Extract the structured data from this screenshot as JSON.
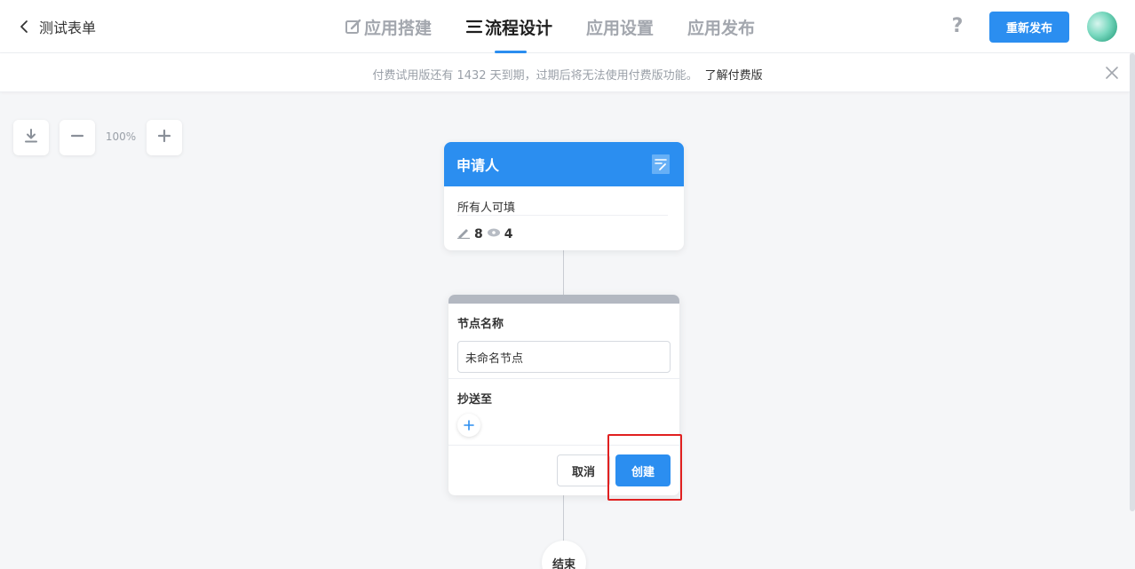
{
  "header": {
    "back_title": "测试表单",
    "tabs": [
      {
        "label": "应用搭建",
        "icon": "edit-icon",
        "active": false
      },
      {
        "label": "流程设计",
        "icon": "list-icon",
        "active": true
      },
      {
        "label": "应用设置",
        "active": false
      },
      {
        "label": "应用发布",
        "active": false
      }
    ],
    "help_label": "?",
    "republish_label": "重新发布"
  },
  "notice": {
    "message": "付费试用版还有 1432 天到期，过期后将无法使用付费版功能。",
    "link_label": "了解付费版"
  },
  "zoom": {
    "level": "100%"
  },
  "applicant_node": {
    "title": "申请人",
    "subtitle": "所有人可填",
    "edit_count": "8",
    "view_count": "4"
  },
  "node_editor": {
    "name_label": "节点名称",
    "name_value": "未命名节点",
    "cc_label": "抄送至",
    "cancel_label": "取消",
    "create_label": "创建"
  },
  "end_node": {
    "label": "结束"
  },
  "colors": {
    "accent": "#2b8ef0",
    "highlight": "#e02020"
  }
}
